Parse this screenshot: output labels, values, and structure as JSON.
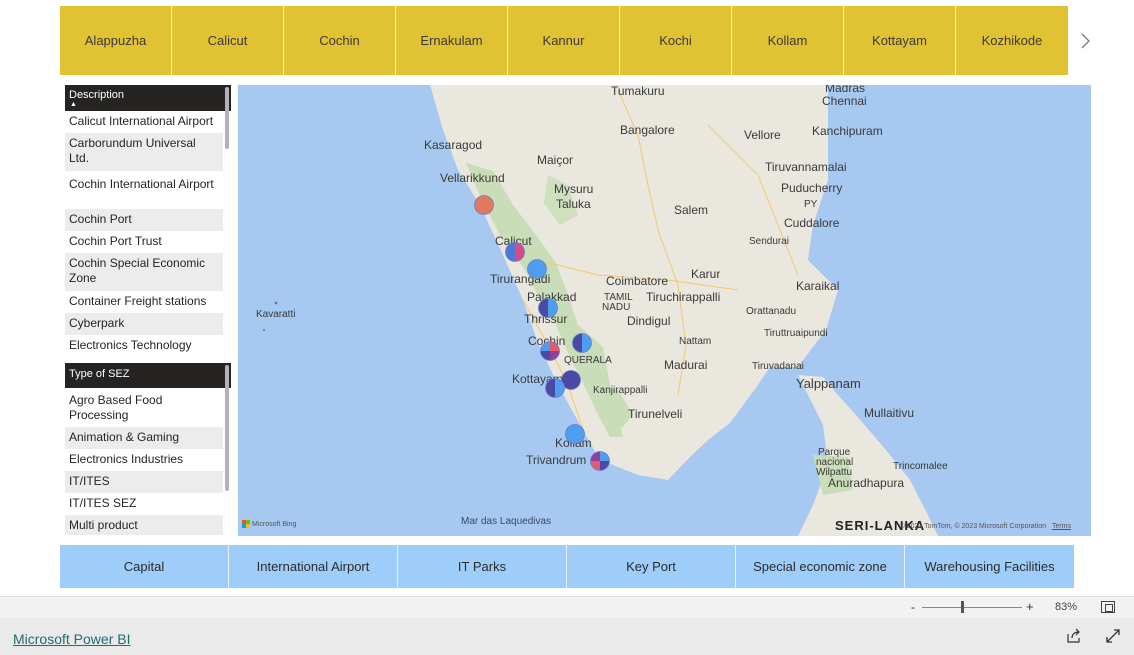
{
  "cities": [
    "Alappuzha",
    "Calicut",
    "Cochin",
    "Ernakulam",
    "Kannur",
    "Kochi",
    "Kollam",
    "Kottayam",
    "Kozhikode"
  ],
  "description_slicer": {
    "header": "Description",
    "items": [
      "Calicut International Airport",
      "Carborundum Universal Ltd.",
      "Cochin International Airport",
      "Cochin Port",
      "Cochin Port Trust",
      "Cochin Special Economic Zone",
      "Container Freight stations",
      "Cyberpark",
      "Electronics Technology"
    ]
  },
  "sez_slicer": {
    "header": "Type of SEZ",
    "items": [
      "Agro Based Food Processing",
      "Animation & Gaming",
      "Electronics Industries",
      "IT/ITES",
      "IT/ITES SEZ",
      "Multi product"
    ]
  },
  "map": {
    "labels": [
      "Tumakuru",
      "Madras",
      "Chennai",
      "Bangalore",
      "Vellore",
      "Kanchipuram",
      "Kasaragod",
      "Maiçor",
      "Tiruvannamalai",
      "Vellarikkund",
      "Mysuru",
      "Taluka",
      "Puducherry",
      "PY",
      "Cuddalore",
      "Salem",
      "Sendurai",
      "Calicut",
      "Tirurangadi",
      "Coimbatore",
      "Karur",
      "Karaikal",
      "Palakkad",
      "TAMIL",
      "NADU",
      "Tiruchirappalli",
      "Kavaratti",
      "Orattanadu",
      "Thrissur",
      "Dindigul",
      "Tiruttruaipundi",
      "Cochin",
      "Nattam",
      "QUERALA",
      "Madurai",
      "Tiruvadanai",
      "Kottayam",
      "Kanjirappalli",
      "Yalppanam",
      "Mullaitivu",
      "Tirunelveli",
      "Kollam",
      "Parque",
      "nacional",
      "Wilpattu",
      "Trincomalee",
      "Trivandrum",
      "Anuradhapura",
      "Mar das Laquedivas",
      "SERI-LANKA"
    ],
    "copyright": "© 2023 TomTom, © 2023 Microsoft Corporation",
    "terms": "Terms",
    "bing": "Microsoft Bing",
    "markers": [
      {
        "name": "Kannur",
        "colors": [
          "#e07a5f"
        ]
      },
      {
        "name": "Calicut",
        "colors": [
          "#d64d86",
          "#4c78d8"
        ]
      },
      {
        "name": "Tirurangadi",
        "colors": [
          "#4f9df0"
        ]
      },
      {
        "name": "Thrissur",
        "colors": [
          "#4f9df0",
          "#4a4aa6"
        ]
      },
      {
        "name": "Cochin north",
        "colors": [
          "#4f9df0",
          "#4a4aa6"
        ]
      },
      {
        "name": "Cochin",
        "colors": [
          "#e85a6a",
          "#8f3fa0",
          "#4a4aa6",
          "#4f9df0"
        ]
      },
      {
        "name": "Kottayam",
        "colors": [
          "#4a4aa6"
        ]
      },
      {
        "name": "Alappuzha",
        "colors": [
          "#4f9df0",
          "#4a4aa6"
        ]
      },
      {
        "name": "Kollam",
        "colors": [
          "#4f9df0"
        ]
      },
      {
        "name": "Trivandrum",
        "colors": [
          "#4f9df0",
          "#4a4aa6",
          "#e85a6a",
          "#8f3fa0"
        ]
      }
    ]
  },
  "categories": [
    "Capital",
    "International Airport",
    "IT Parks",
    "Key Port",
    "Special economic zone",
    "Warehousing Facilities"
  ],
  "zoom": {
    "minus": "-",
    "plus": "+",
    "percent": "83%"
  },
  "footer": {
    "link": "Microsoft Power BI"
  }
}
